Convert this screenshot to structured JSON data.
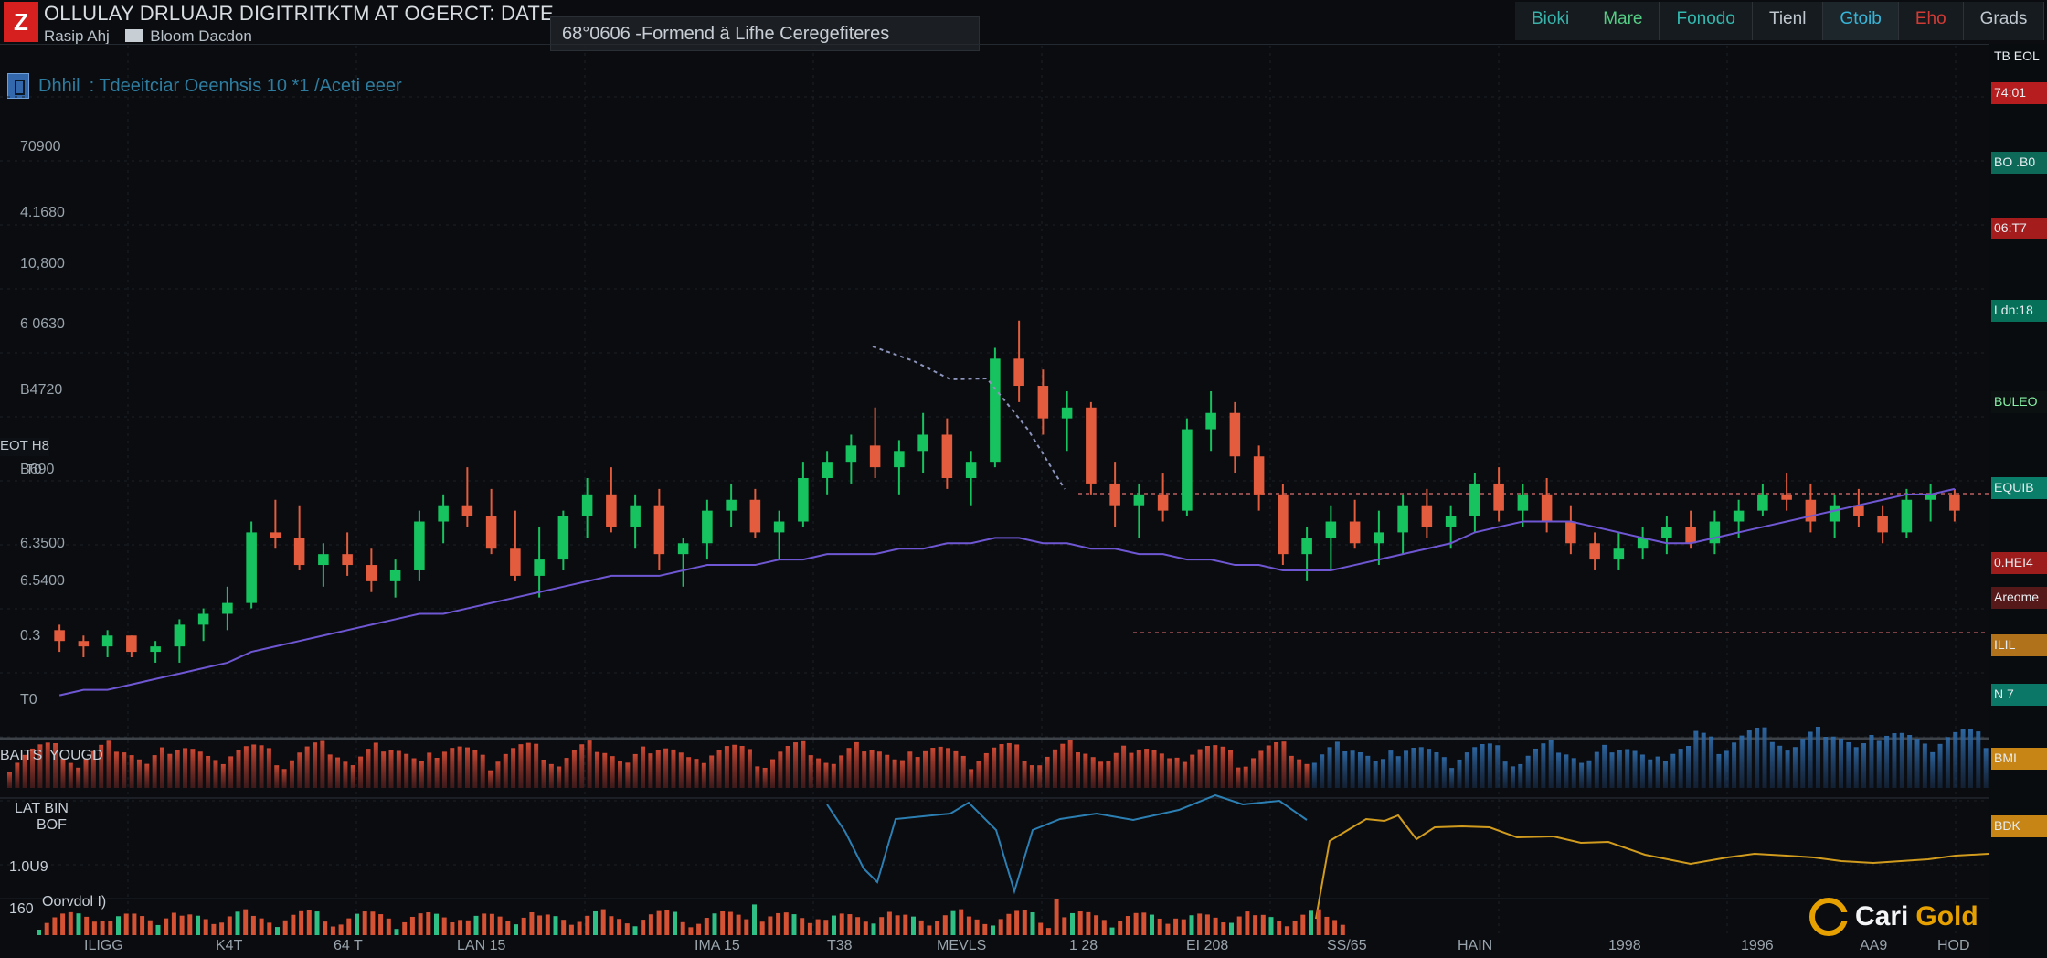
{
  "header": {
    "logo": "Z",
    "title": "OLLULAY DRLUAJR DIGITRITKTM AT OGERCT: DATE",
    "subtitle_left": "Rasip Ahj",
    "subtitle_right": "Bloom Dacdon",
    "search_value": "68°0606  -Formend ä Lifhe  Ceregefiteres",
    "tabs": [
      "Bioki",
      "Mare",
      "Fonodo",
      "Tienl",
      "Gtoib",
      "Eho",
      "Grads"
    ]
  },
  "chart_panel": {
    "symbol_label": "Dhhil",
    "description": ": Tdeeitciar Oeenhsis 10 *1 /Aceti eeer",
    "y_ticks": [
      "70900",
      "4.1680",
      "10,800",
      "6 0630",
      "B4720",
      "B690",
      "6.3500",
      "6.5400",
      "0.3",
      "T0"
    ],
    "left_badges": [
      "EOT  H8",
      "T0"
    ],
    "volume_label": "BAITS",
    "volume_value": "YOUGD",
    "lower_labels": [
      "LAT BIN",
      "BOF",
      "1.0U9",
      "Oorvdol  I)",
      "160"
    ],
    "right_tags": [
      {
        "text": "TB EOL",
        "color": "#121519"
      },
      {
        "text": "74:01",
        "color": "#b51d1f"
      },
      {
        "text": "BO .B0",
        "color": "#0d6a58"
      },
      {
        "text": "06:T7",
        "color": "#a51c1c"
      },
      {
        "text": "Ldn:18",
        "color": "#067058"
      },
      {
        "text": "BULEO",
        "color": "#0a1110"
      },
      {
        "text": "EQUIB",
        "color": "#0a7e68"
      },
      {
        "text": "0.HEI4",
        "color": "#9d1c1c"
      },
      {
        "text": "Areome",
        "color": "#561919"
      },
      {
        "text": "ILIL",
        "color": "#b0721a"
      },
      {
        "text": "N 7",
        "color": "#0b7767"
      },
      {
        "text": "BMI",
        "color": "#c78516"
      },
      {
        "text": "BDK",
        "color": "#c78516"
      }
    ],
    "chart_data": {
      "type": "candlestick",
      "title": "OLLULAY DRLUAJR DIGITRITKTM AT OGERCT: DATE",
      "ylabel": "",
      "ylim": [
        0,
        100
      ],
      "grid": true,
      "indicator_lines": [
        "purple",
        "teal",
        "orange"
      ],
      "ohlc": [
        [
          22,
          23,
          18,
          20
        ],
        [
          20,
          21,
          17,
          19
        ],
        [
          19,
          22,
          17,
          21
        ],
        [
          21,
          21,
          17,
          18
        ],
        [
          18,
          20,
          16,
          19
        ],
        [
          19,
          24,
          16,
          23
        ],
        [
          23,
          26,
          20,
          25
        ],
        [
          25,
          30,
          22,
          27
        ],
        [
          27,
          42,
          26,
          40
        ],
        [
          40,
          46,
          37,
          39
        ],
        [
          39,
          45,
          33,
          34
        ],
        [
          34,
          38,
          30,
          36
        ],
        [
          36,
          40,
          32,
          34
        ],
        [
          34,
          37,
          29,
          31
        ],
        [
          31,
          35,
          28,
          33
        ],
        [
          33,
          44,
          31,
          42
        ],
        [
          42,
          47,
          38,
          45
        ],
        [
          45,
          52,
          41,
          43
        ],
        [
          43,
          48,
          36,
          37
        ],
        [
          37,
          44,
          31,
          32
        ],
        [
          32,
          41,
          28,
          35
        ],
        [
          35,
          44,
          33,
          43
        ],
        [
          43,
          50,
          39,
          47
        ],
        [
          47,
          52,
          40,
          41
        ],
        [
          41,
          47,
          37,
          45
        ],
        [
          45,
          48,
          33,
          36
        ],
        [
          36,
          39,
          30,
          38
        ],
        [
          38,
          46,
          35,
          44
        ],
        [
          44,
          49,
          41,
          46
        ],
        [
          46,
          48,
          39,
          40
        ],
        [
          40,
          44,
          35,
          42
        ],
        [
          42,
          53,
          41,
          50
        ],
        [
          50,
          55,
          47,
          53
        ],
        [
          53,
          58,
          49,
          56
        ],
        [
          56,
          63,
          50,
          52
        ],
        [
          52,
          57,
          47,
          55
        ],
        [
          55,
          62,
          51,
          58
        ],
        [
          58,
          61,
          48,
          50
        ],
        [
          50,
          55,
          45,
          53
        ],
        [
          53,
          74,
          52,
          72
        ],
        [
          72,
          79,
          64,
          67
        ],
        [
          67,
          70,
          58,
          61
        ],
        [
          61,
          66,
          55,
          63
        ],
        [
          63,
          64,
          47,
          49
        ],
        [
          49,
          53,
          41,
          45
        ],
        [
          45,
          49,
          39,
          47
        ],
        [
          47,
          51,
          42,
          44
        ],
        [
          44,
          61,
          43,
          59
        ],
        [
          59,
          66,
          55,
          62
        ],
        [
          62,
          64,
          51,
          54
        ],
        [
          54,
          56,
          44,
          47
        ],
        [
          47,
          49,
          34,
          36
        ],
        [
          36,
          41,
          31,
          39
        ],
        [
          39,
          45,
          33,
          42
        ],
        [
          42,
          46,
          37,
          38
        ],
        [
          38,
          44,
          34,
          40
        ],
        [
          40,
          47,
          36,
          45
        ],
        [
          45,
          48,
          39,
          41
        ],
        [
          41,
          45,
          37,
          43
        ],
        [
          43,
          51,
          40,
          49
        ],
        [
          49,
          52,
          42,
          44
        ],
        [
          44,
          49,
          41,
          47
        ],
        [
          47,
          50,
          40,
          42
        ],
        [
          42,
          45,
          36,
          38
        ],
        [
          38,
          40,
          33,
          35
        ],
        [
          35,
          40,
          33,
          37
        ],
        [
          37,
          41,
          35,
          39
        ],
        [
          39,
          43,
          36,
          41
        ],
        [
          41,
          44,
          37,
          38
        ],
        [
          38,
          44,
          36,
          42
        ],
        [
          42,
          46,
          39,
          44
        ],
        [
          44,
          49,
          43,
          47
        ],
        [
          47,
          51,
          44,
          46
        ],
        [
          46,
          49,
          40,
          42
        ],
        [
          42,
          47,
          39,
          45
        ],
        [
          45,
          48,
          41,
          43
        ],
        [
          43,
          45,
          38,
          40
        ],
        [
          40,
          48,
          39,
          46
        ],
        [
          46,
          49,
          42,
          47
        ],
        [
          47,
          48,
          42,
          44
        ]
      ]
    }
  },
  "x_axis": [
    "ILIGG",
    "K4T",
    "64 T",
    "LAN 15",
    "IMA 15",
    "T38",
    "MEVLS",
    "1 28",
    "EI 208",
    "SS/65",
    "HAIN",
    "1998",
    "1996",
    "AA9",
    "HOD"
  ],
  "brand": {
    "prefix": "Cari",
    "suffix": "Gold"
  }
}
